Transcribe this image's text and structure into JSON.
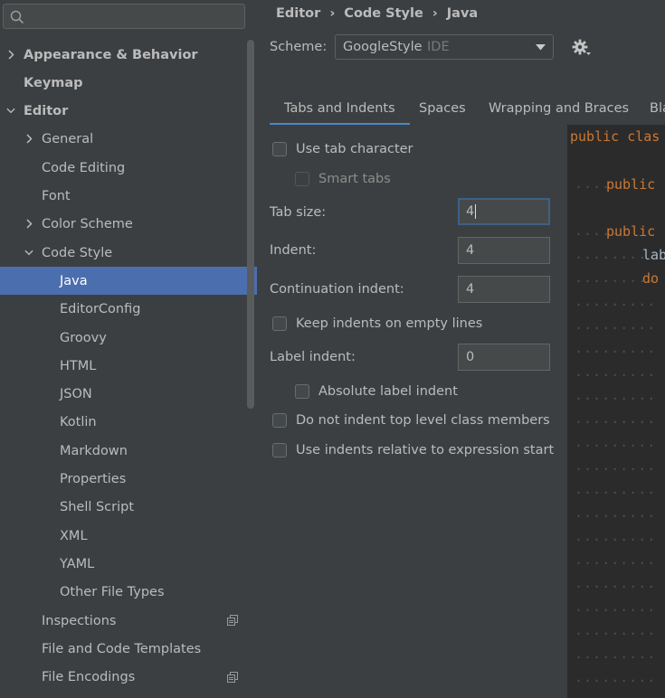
{
  "search": {
    "placeholder": ""
  },
  "tree": {
    "items": [
      {
        "label": "Appearance & Behavior",
        "bold": true,
        "arrow": "right"
      },
      {
        "label": "Keymap",
        "bold": true,
        "arrow": ""
      },
      {
        "label": "Editor",
        "bold": true,
        "arrow": "down"
      },
      {
        "label": "General",
        "arrow": "right"
      },
      {
        "label": "Code Editing",
        "arrow": ""
      },
      {
        "label": "Font",
        "arrow": ""
      },
      {
        "label": "Color Scheme",
        "arrow": "right"
      },
      {
        "label": "Code Style",
        "arrow": "down"
      },
      {
        "label": "Java",
        "arrow": "",
        "selected": true
      },
      {
        "label": "EditorConfig",
        "arrow": ""
      },
      {
        "label": "Groovy",
        "arrow": ""
      },
      {
        "label": "HTML",
        "arrow": ""
      },
      {
        "label": "JSON",
        "arrow": ""
      },
      {
        "label": "Kotlin",
        "arrow": ""
      },
      {
        "label": "Markdown",
        "arrow": ""
      },
      {
        "label": "Properties",
        "arrow": ""
      },
      {
        "label": "Shell Script",
        "arrow": ""
      },
      {
        "label": "XML",
        "arrow": ""
      },
      {
        "label": "YAML",
        "arrow": ""
      },
      {
        "label": "Other File Types",
        "arrow": ""
      },
      {
        "label": "Inspections",
        "arrow": "",
        "icon": "copy-settings-icon"
      },
      {
        "label": "File and Code Templates",
        "arrow": ""
      },
      {
        "label": "File Encodings",
        "arrow": "",
        "icon": "copy-settings-icon"
      }
    ]
  },
  "breadcrumb": [
    "Editor",
    "Code Style",
    "Java"
  ],
  "scheme": {
    "label": "Scheme:",
    "name": "GoogleStyle",
    "kind": "IDE"
  },
  "tabs": [
    "Tabs and Indents",
    "Spaces",
    "Wrapping and Braces",
    "Bla"
  ],
  "form": {
    "use_tab_character": "Use tab character",
    "smart_tabs": "Smart tabs",
    "tab_size_label": "Tab size:",
    "tab_size_value": "4",
    "indent_label": "Indent:",
    "indent_value": "4",
    "continuation_label": "Continuation indent:",
    "continuation_value": "4",
    "keep_indents": "Keep indents on empty lines",
    "label_indent_label": "Label indent:",
    "label_indent_value": "0",
    "absolute_label_indent": "Absolute label indent",
    "do_not_indent_top": "Do not indent top level class members",
    "use_indents_relative": "Use indents relative to expression start"
  },
  "preview": {
    "lines": [
      {
        "kw": "public",
        "rest": " clas"
      },
      {
        "kw": "public",
        "rest": ""
      },
      {
        "kw": "public",
        "rest": ""
      },
      {
        "kw": "",
        "rest": "lab"
      },
      {
        "kw": "do",
        "rest": ""
      }
    ]
  },
  "colors": {
    "selection": "#4b6eaf",
    "keyword": "#cc7832",
    "accent": "#4a88c7"
  }
}
